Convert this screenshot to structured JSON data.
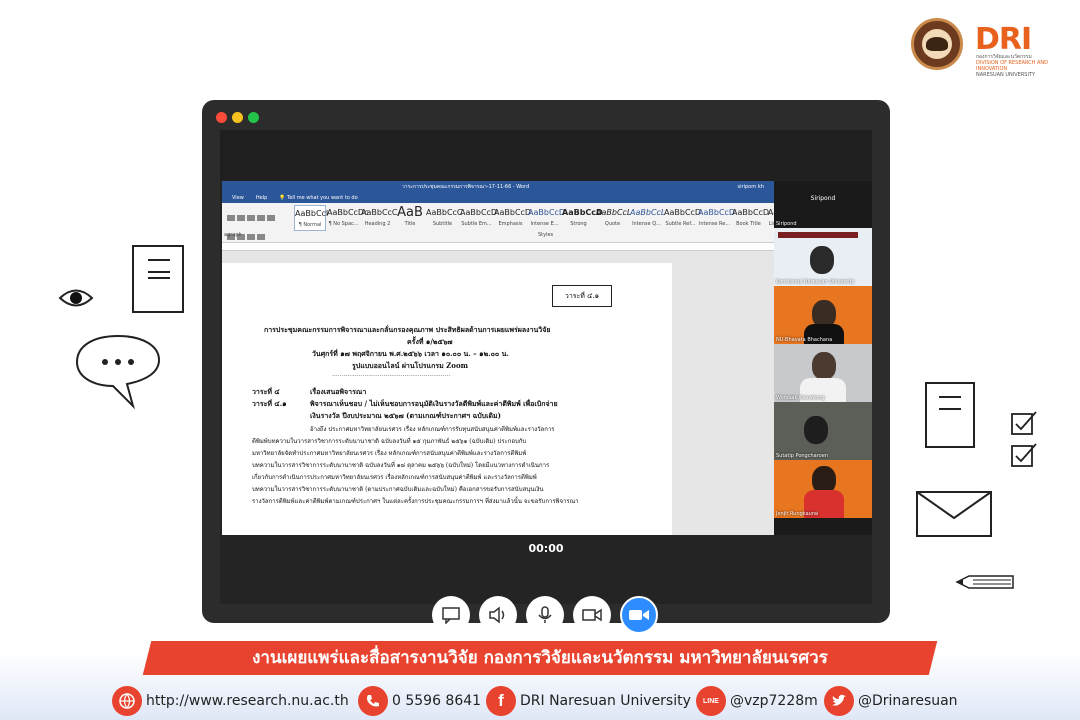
{
  "brand": {
    "logo_text": "DRI",
    "sub_lines": [
      "กองการวิจัยและนวัตกรรม",
      "DIVISION OF RESEARCH AND INNOVATION",
      "NARESUAN UNIVERSITY"
    ]
  },
  "word": {
    "window_title": "วาระการประชุมคณะกรรมการพิจารณา-17-11-66 - Word",
    "user": "siriporn kh",
    "menu": [
      "View",
      "Help",
      "Tell me what you want to do"
    ],
    "styles": [
      {
        "sample": "AaBbCcI",
        "name": "¶ Normal"
      },
      {
        "sample": "AaBbCcDc",
        "name": "¶ No Spac..."
      },
      {
        "sample": "AaBbCcC",
        "name": "Heading 2"
      },
      {
        "sample": "AaB",
        "name": "Title"
      },
      {
        "sample": "AaBbCcC",
        "name": "Subtitle"
      },
      {
        "sample": "AaBbCcD",
        "name": "Subtle Em..."
      },
      {
        "sample": "AaBbCcD",
        "name": "Emphasis"
      },
      {
        "sample": "AaBbCcD",
        "name": "Intense E..."
      },
      {
        "sample": "AaBbCcD",
        "name": "Strong"
      },
      {
        "sample": "AaBbCcL",
        "name": "Quote"
      },
      {
        "sample": "AaBbCcL",
        "name": "Intense Q..."
      },
      {
        "sample": "AaBbCcD",
        "name": "Subtle Ref..."
      },
      {
        "sample": "AaBbCcD",
        "name": "Intense Re..."
      },
      {
        "sample": "AaBbCcD",
        "name": "Book Title"
      },
      {
        "sample": "Aa",
        "name": "List"
      }
    ],
    "group_paragraph": "agraph",
    "group_styles": "Styles"
  },
  "document": {
    "agenda_box": "วาระที่ ๔.๑",
    "heading1": "การประชุมคณะกรรมการพิจารณาและกลั่นกรองคุณภาพ ประสิทธิผลด้านการเผยแพร่ผลงานวิจัย",
    "heading2": "ครั้งที่ ๑/๒๕๖๗",
    "heading3": "วันศุกร์ที่ ๑๗ พฤศจิกายน พ.ศ.๒๕๖๖   เวลา ๑๐.๐๐ น. – ๑๒.๐๐ น.",
    "heading4": "รูปแบบออนไลน์ ผ่านโปรแกรม Zoom",
    "divider": "..............................................................",
    "agenda4_label": "วาระที่   ๔",
    "agenda4_title": "เรื่องเสนอพิจารณา",
    "agenda41_label": "วาระที่   ๔.๑",
    "agenda41_title": "พิจารณาเห็นชอบ / ไม่เห็นชอบการอนุมัติเงินรางวัลตีพิมพ์และค่าตีพิมพ์ เพื่อเบิกจ่าย",
    "agenda41_title2": "เงินรางวัล ปีงบประมาณ ๒๕๖๗ (ตามเกณฑ์ประกาศฯ ฉบับเดิม)",
    "body": [
      "อ้างถึง ประกาศมหาวิทยาลัยนเรศวร เรื่อง หลักเกณฑ์การรับทุนสนับสนุนค่าตีพิมพ์และรางวัลการ",
      "ตีพิมพ์บทความในวารสารวิชาการระดับนานาชาติ ฉบับลงวันที่ ๑๕ กุมภาพันธ์ ๒๕๖๑ (ฉบับเดิม) ประกอบกับ",
      "มหาวิทยาลัยจัดทำประกาศมหาวิทยาลัยนเรศวร เรื่อง หลักเกณฑ์การสนับสนุนค่าตีพิมพ์และรางวัลการตีพิมพ์",
      "บทความในวารสารวิชาการระดับนานาชาติ ฉบับลงวันที่ ๑๘ ตุลาคม ๒๕๖๖ (ฉบับใหม่) โดยมีแนวทางการดำเนินการ",
      "เกี่ยวกับการดำเนินการประกาศมหาวิทยาลัยนเรศวร เรื่องหลักเกณฑ์การสนับสนุนค่าตีพิมพ์ และรางวัลการตีพิมพ์",
      "บทความในวารสารวิชาการระดับนานาชาติ (ตามประกาศฉบับเดิมและฉบับใหม่) คือเอกสารขอรับการสนับสนุนเงิน",
      "รางวัลการตีพิมพ์และค่าตีพิมพ์ตามเกณฑ์ประกาศฯ ในแต่ละครั้งการประชุมคณะกรรมการฯ ที่ส่งมาแล้วนั้น จะขอรับการพิจารณา"
    ]
  },
  "participants": [
    {
      "name": "Siripond"
    },
    {
      "name": "Kornkanok Naresuan University"
    },
    {
      "name": "NU-Bhavata Bhachana"
    },
    {
      "name": "Worasak Kaewkong"
    },
    {
      "name": "Sutatip Pongcharoen"
    },
    {
      "name": "Jenjit Rungkaurai"
    }
  ],
  "meeting": {
    "timer": "00:00"
  },
  "footer": {
    "banner": "งานเผยแพร่และสื่อสารงานวิจัย กองการวิจัยและนวัตกรรม มหาวิทยาลัยนเรศวร",
    "website": "http://www.research.nu.ac.th",
    "phone": "0 5596 8641",
    "facebook": "DRI Naresuan University",
    "line": "@vzp7228m",
    "twitter": "@Drinaresuan"
  },
  "colors": {
    "accent": "#e8432e",
    "word_blue": "#2b579a",
    "zoom_blue": "#2d8cff"
  }
}
